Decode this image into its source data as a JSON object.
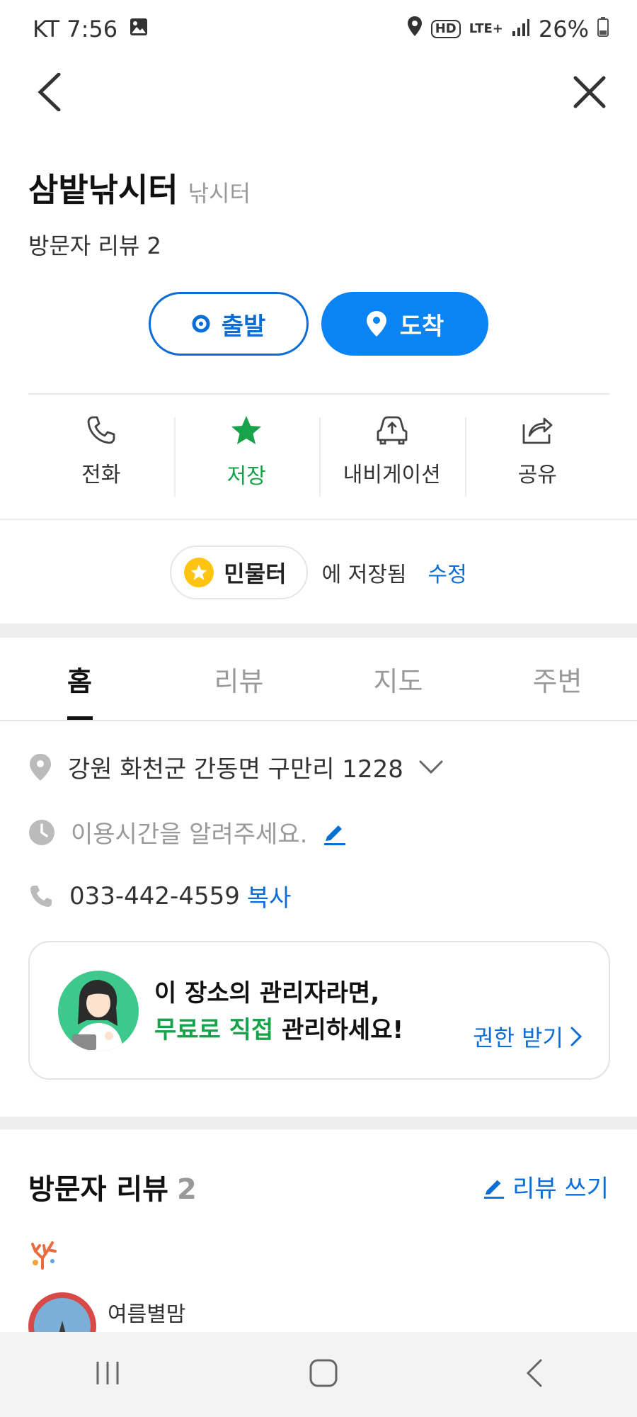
{
  "status_bar": {
    "carrier_time": "KT 7:56",
    "network": "LTE+",
    "hd": "HD",
    "battery": "26%"
  },
  "place": {
    "name": "삼밭낚시터",
    "category": "낚시터",
    "review_summary": "방문자 리뷰 2"
  },
  "route": {
    "depart_label": "출발",
    "arrive_label": "도착"
  },
  "actions": {
    "call": "전화",
    "save": "저장",
    "navigate": "내비게이션",
    "share": "공유"
  },
  "saved": {
    "folder": "민물터",
    "text": "에 저장됨",
    "edit": "수정"
  },
  "tabs": {
    "home": "홈",
    "review": "리뷰",
    "map": "지도",
    "nearby": "주변"
  },
  "info": {
    "address": "강원 화천군 간동면 구만리 1228",
    "hours_prompt": "이용시간을 알려주세요.",
    "phone": "033-442-4559",
    "copy": "복사"
  },
  "owner_card": {
    "line1": "이 장소의 관리자라면,",
    "line2_highlight": "무료로 직접",
    "line2_rest": " 관리하세요!",
    "link": "권한 받기"
  },
  "reviews": {
    "title": "방문자 리뷰",
    "count": "2",
    "write": "리뷰 쓰기",
    "first_reviewer": "여름별맘"
  },
  "colors": {
    "primary_blue": "#0a84f4",
    "link_blue": "#0b6dd6",
    "green": "#17a34a",
    "star_yellow": "#ffc412"
  }
}
